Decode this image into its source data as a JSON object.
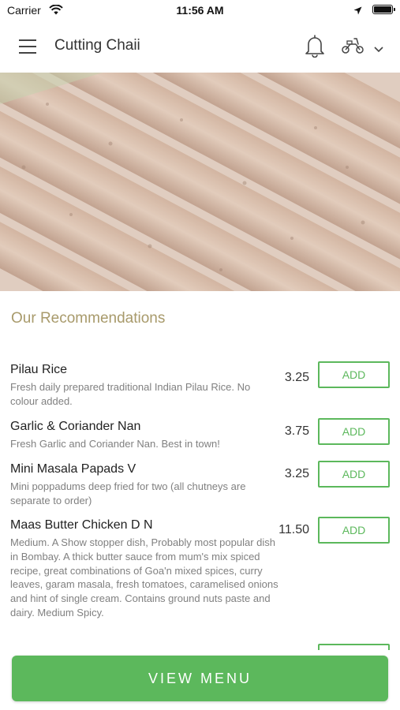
{
  "status_bar": {
    "carrier": "Carrier",
    "time": "11:56 AM"
  },
  "header": {
    "title": "Cutting Chaii",
    "icons": [
      "menu-icon",
      "bell-icon",
      "scooter-icon",
      "chevron-down-icon"
    ]
  },
  "hero": {
    "image": "seekh kebab photo"
  },
  "recommendations": {
    "title": "Our Recommendations",
    "items": [
      {
        "name": "Pilau Rice",
        "description": "Fresh daily prepared traditional Indian Pilau Rice. No colour added.",
        "price": "3.25",
        "add_label": "ADD"
      },
      {
        "name": "Garlic & Coriander Nan",
        "description": "Fresh Garlic and Coriander Nan. Best in town!",
        "price": "3.75",
        "add_label": "ADD"
      },
      {
        "name": "Mini Masala Papads V",
        "description": "Mini poppadums deep fried for two (all chutneys are separate to order)",
        "price": "3.25",
        "add_label": "ADD"
      },
      {
        "name": "Maas Butter Chicken D N",
        "description": "Medium. A Show stopper dish, Probably most popular dish in Bombay. A thick butter sauce from mum's mix spiced recipe, great combinations of Goa'n mixed spices, curry leaves, garam masala, fresh tomatoes, caramelised onions and hint of single cream. Contains ground nuts paste and dairy. Medium Spicy.",
        "price": "11.50",
        "add_label": "ADD"
      }
    ]
  },
  "footer": {
    "view_menu_label": "VIEW MENU"
  },
  "colors": {
    "accent_green": "#5cb85c",
    "section_title": "#a89a6b",
    "description_gray": "#808080"
  }
}
